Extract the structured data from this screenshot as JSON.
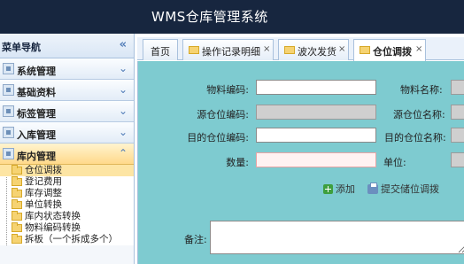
{
  "app": {
    "title": "WMS仓库管理系统"
  },
  "sidebar": {
    "header": "菜单导航",
    "collapse_icon": "«",
    "sections": [
      {
        "label": "系统管理",
        "chevron": "⌄"
      },
      {
        "label": "基础资料",
        "chevron": "⌄"
      },
      {
        "label": "标签管理",
        "chevron": "⌄"
      },
      {
        "label": "入库管理",
        "chevron": "⌄"
      },
      {
        "label": "库内管理",
        "chevron": "⌃"
      }
    ],
    "tree": [
      "仓位调拨",
      "登记费用",
      "库存调整",
      "单位转换",
      "库内状态转换",
      "物料编码转换",
      "拆板（一个拆成多个）"
    ]
  },
  "tabs": [
    {
      "label": "首页",
      "close": ""
    },
    {
      "label": "操作记录明细",
      "close": "×"
    },
    {
      "label": "波次发货",
      "close": "×"
    },
    {
      "label": "仓位调拨",
      "close": "×"
    }
  ],
  "form": {
    "material_code": "物料编码:",
    "material_name": "物料名称:",
    "source_code": "源仓位编码:",
    "source_name": "源仓位名称:",
    "target_code": "目的仓位编码:",
    "target_name": "目的仓位名称:",
    "qty": "数量:",
    "unit": "单位:",
    "add": "添加",
    "submit": "提交储位调拨",
    "remark": "备注:"
  },
  "colors": {
    "topbar": "#17263f",
    "content_bg": "#7ecbd0",
    "active_section": "#ffd98a"
  }
}
